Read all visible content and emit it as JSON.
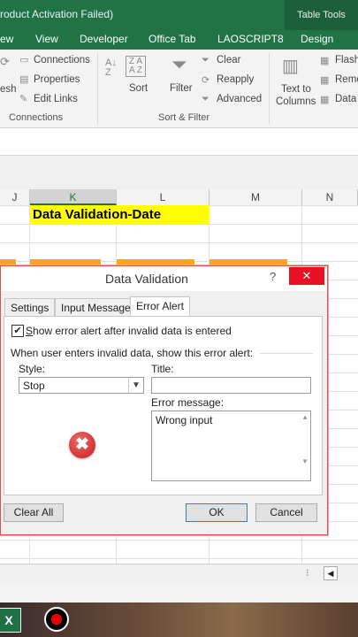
{
  "window": {
    "title": "roduct Activation Failed)",
    "context_tab": "Table Tools"
  },
  "ribbon_tabs": [
    "ew",
    "View",
    "Developer",
    "Office Tab",
    "LAOSCRIPT8",
    "Design"
  ],
  "ribbon": {
    "connections": {
      "items": [
        "Connections",
        "Properties",
        "Edit Links"
      ],
      "left_label": "esh",
      "group": "Connections"
    },
    "sort": {
      "label": "Sort"
    },
    "filter": {
      "label": "Filter",
      "items": [
        "Clear",
        "Reapply",
        "Advanced"
      ]
    },
    "sort_filter_group": "Sort & Filter",
    "data_tools": {
      "text_to_columns": [
        "Text to",
        "Columns"
      ],
      "items": [
        "Flash",
        "Remo",
        "Data"
      ]
    }
  },
  "grid": {
    "columns": [
      "J",
      "K",
      "L",
      "M",
      "N"
    ],
    "selected_column": "K",
    "cell_k1": "Data Validation-Date"
  },
  "dialog": {
    "title": "Data Validation",
    "help": "?",
    "close": "✕",
    "tabs": [
      "Settings",
      "Input Message",
      "Error Alert"
    ],
    "active_tab": "Error Alert",
    "show_alert_checkbox": {
      "checked": true,
      "label_prefix": "S",
      "label_rest": "how error alert after invalid data is entered"
    },
    "section_label": "When user enters invalid data, show this error alert:",
    "style_label": "Style:",
    "style_value": "Stop",
    "title_label": "Title:",
    "title_value": "",
    "error_message_label": "Error message:",
    "error_message_value": "Wrong input",
    "buttons": {
      "clear_all": "Clear All",
      "ok": "OK",
      "cancel": "Cancel"
    }
  },
  "colors": {
    "excel_green": "#217346",
    "close_red": "#e81123",
    "highlight_yellow": "#ffff00",
    "header_orange": "#f5a623"
  }
}
